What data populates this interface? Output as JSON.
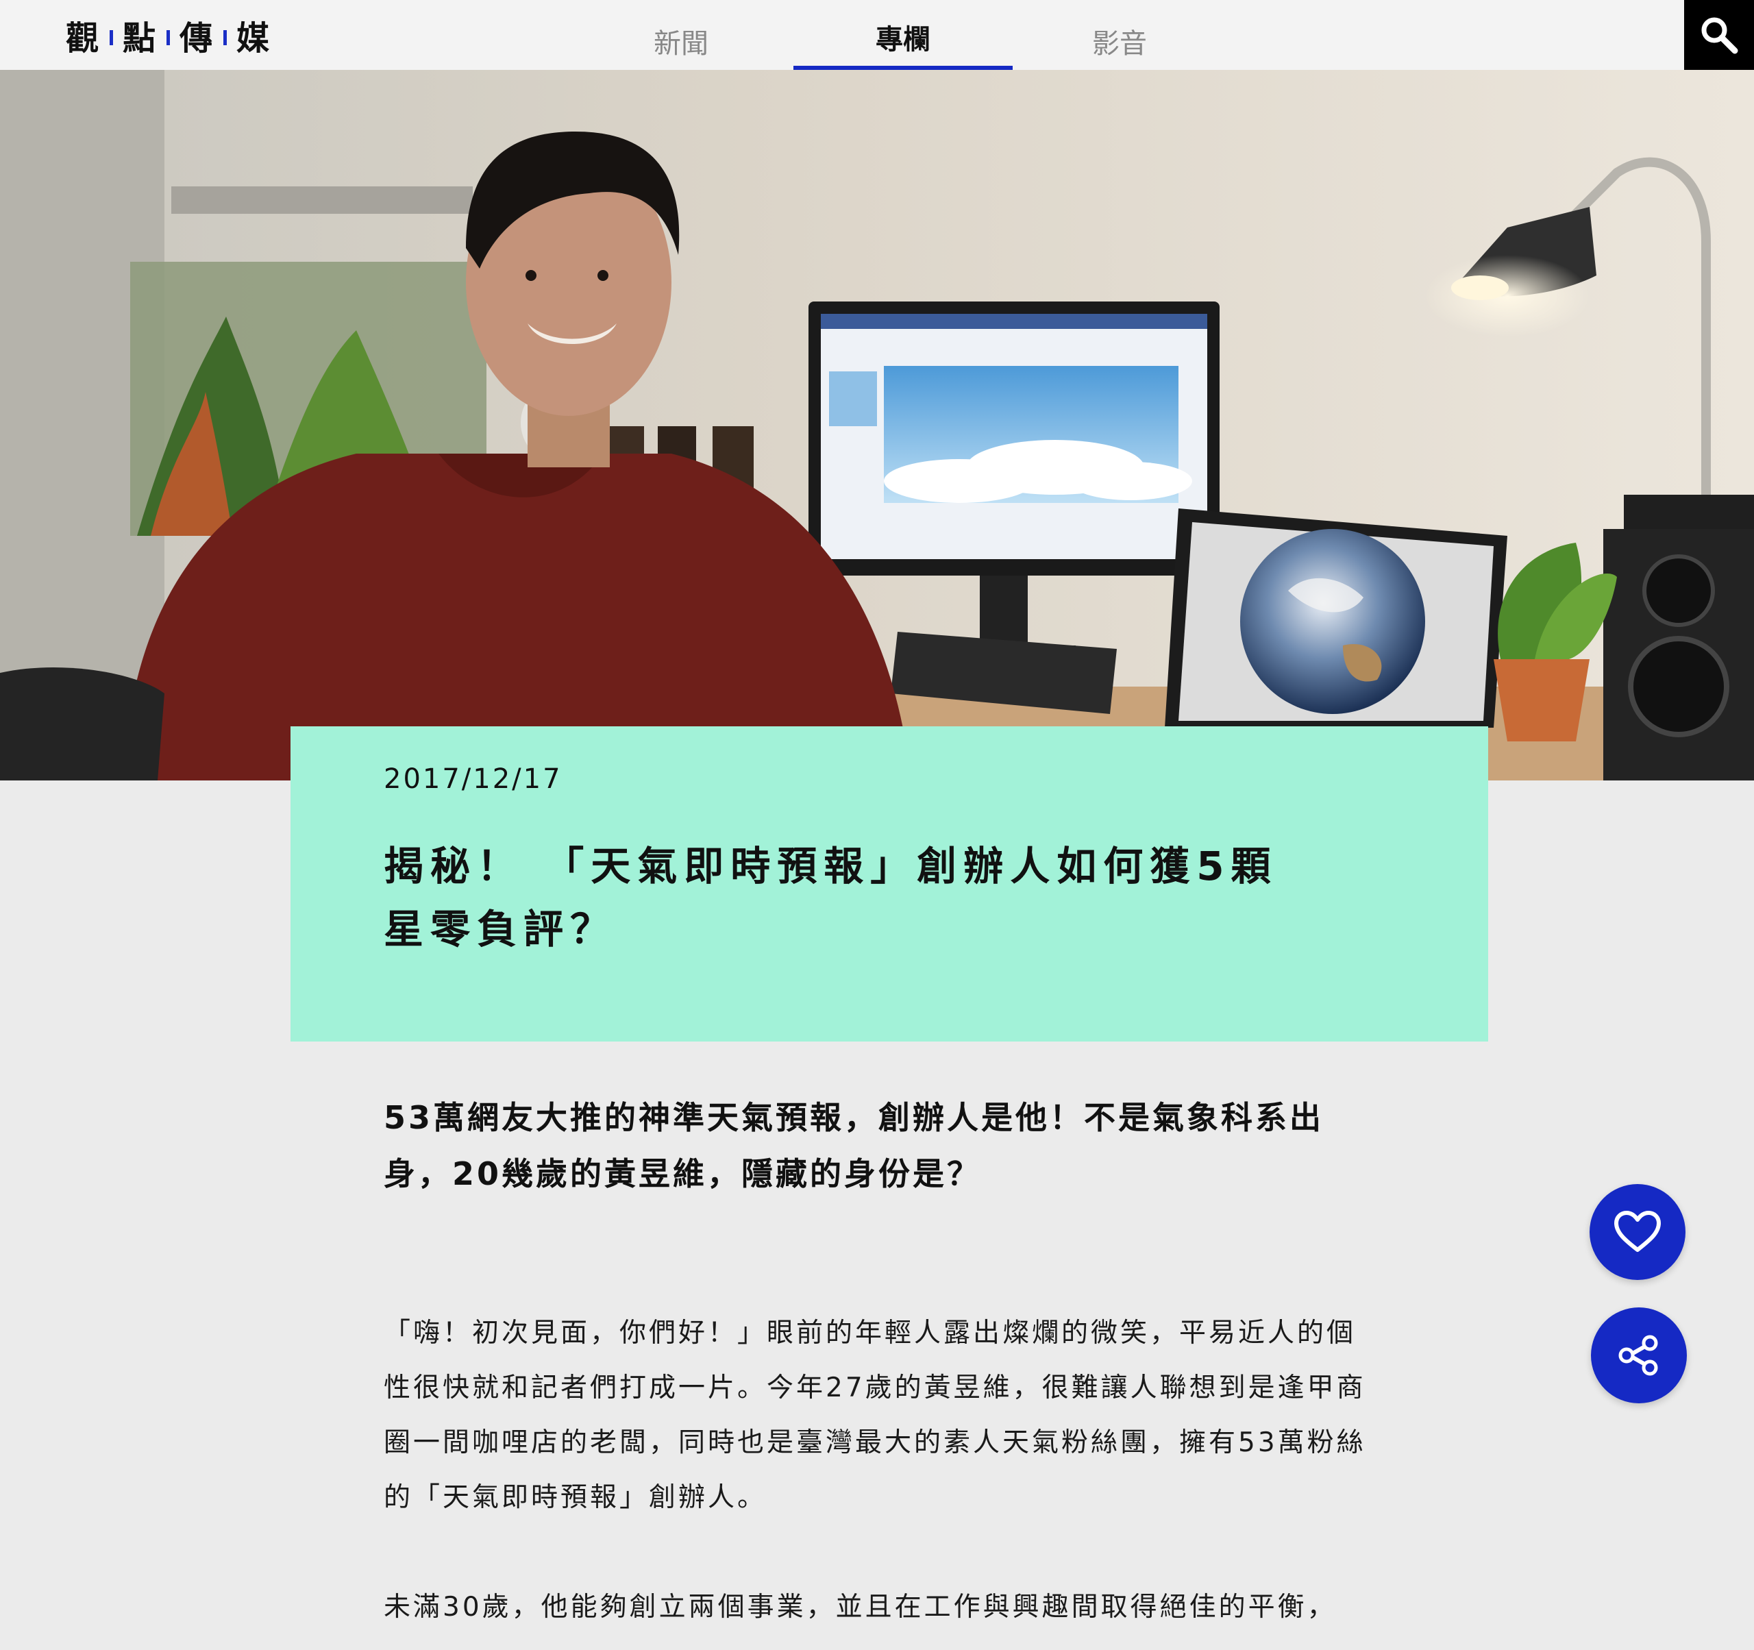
{
  "site": {
    "logo_chars": [
      "觀",
      "點",
      "傳",
      "媒"
    ]
  },
  "nav": {
    "tabs": [
      {
        "label": "新聞",
        "active": false
      },
      {
        "label": "專欄",
        "active": true
      },
      {
        "label": "影音",
        "active": false
      }
    ],
    "search_icon": "search-icon"
  },
  "colors": {
    "accent": "#1529c4",
    "card_background": "#a2f2d8",
    "page_background": "#ebebeb"
  },
  "article": {
    "date": "2017/12/17",
    "title_lines": [
      "揭秘！ 「天氣即時預報」創辦人如何獲5顆",
      "星零負評？"
    ],
    "lede": "53萬網友大推的神準天氣預報，創辦人是他！不是氣象科系出身，20幾歲的黃昱維，隱藏的身份是？",
    "paragraphs": [
      "「嗨！初次見面，你們好！」眼前的年輕人露出燦爛的微笑，平易近人的個性很快就和記者們打成一片。今年27歲的黃昱維，很難讓人聯想到是逢甲商圈一間咖哩店的老闆，同時也是臺灣最大的素人天氣粉絲團，擁有53萬粉絲的「天氣即時預報」創辦人。",
      "未滿30歲，他能夠創立兩個事業，並且在工作與興趣間取得絕佳的平衡，"
    ]
  },
  "actions": {
    "like_icon": "heart-icon",
    "share_icon": "share-icon"
  }
}
